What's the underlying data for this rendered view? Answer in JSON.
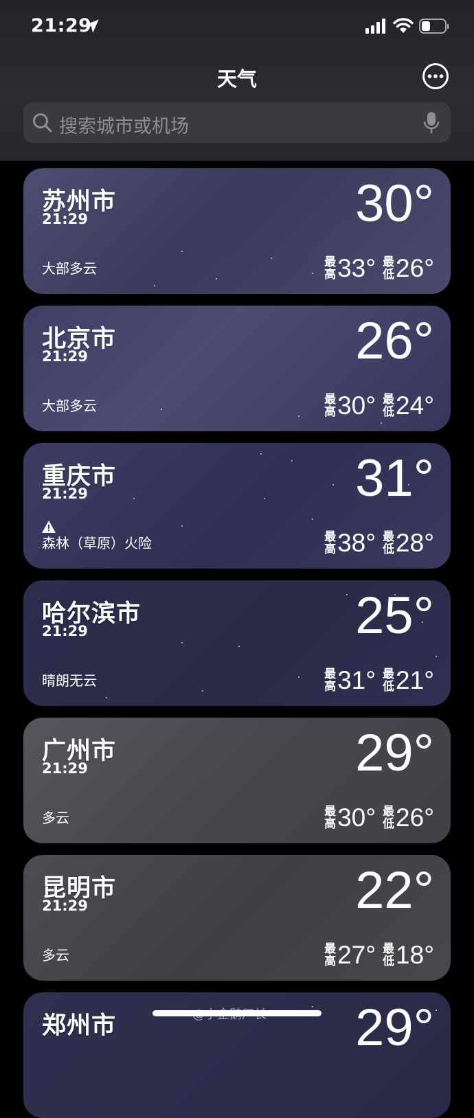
{
  "status_bar": {
    "time": "21:29"
  },
  "header": {
    "title": "天气"
  },
  "search": {
    "placeholder": "搜索城市或机场"
  },
  "labels": {
    "high_top": "最",
    "high_bottom": "高",
    "low_top": "最",
    "low_bottom": "低"
  },
  "cities": [
    {
      "name": "苏州市",
      "time": "21:29",
      "condition": "大部多云",
      "temp": "30°",
      "high": "33°",
      "low": "26°"
    },
    {
      "name": "北京市",
      "time": "21:29",
      "condition": "大部多云",
      "temp": "26°",
      "high": "30°",
      "low": "24°"
    },
    {
      "name": "重庆市",
      "time": "21:29",
      "condition": "森林（草原）火险",
      "temp": "31°",
      "high": "38°",
      "low": "28°",
      "alert_icon": "warning-icon"
    },
    {
      "name": "哈尔滨市",
      "time": "21:29",
      "condition": "晴朗无云",
      "temp": "25°",
      "high": "31°",
      "low": "21°"
    },
    {
      "name": "广州市",
      "time": "21:29",
      "condition": "多云",
      "temp": "29°",
      "high": "30°",
      "low": "26°"
    },
    {
      "name": "昆明市",
      "time": "21:29",
      "condition": "多云",
      "temp": "22°",
      "high": "27°",
      "low": "18°"
    },
    {
      "name": "郑州市",
      "temp": "29°"
    }
  ],
  "watermark": "@小企鹅厂长",
  "colors": {
    "accent": "#ffffff",
    "card_cloudy_night": "#3c3b5e",
    "card_clear_night": "#2a2a4a",
    "card_cloudy_gray": "#4a4c52"
  }
}
